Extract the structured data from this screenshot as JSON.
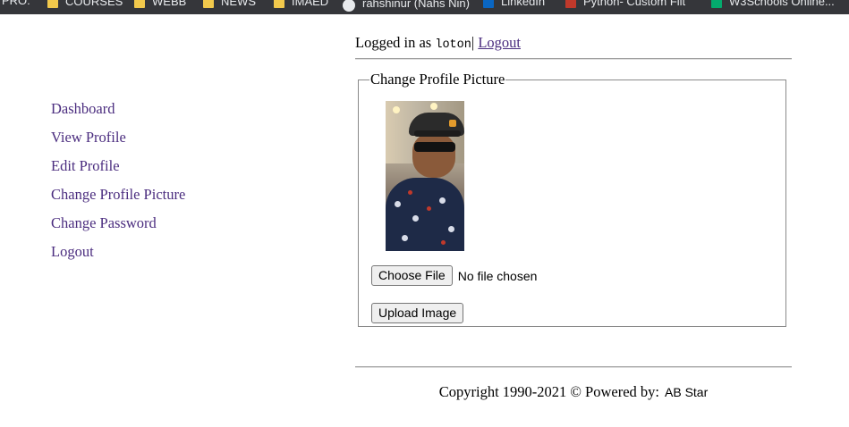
{
  "bookmarks": [
    {
      "label": "PRO:",
      "icon": "none"
    },
    {
      "label": "COURSES",
      "icon": "folder-icon"
    },
    {
      "label": "WEBB",
      "icon": "folder-icon"
    },
    {
      "label": "NEWS",
      "icon": "folder-icon"
    },
    {
      "label": "IMAED",
      "icon": "folder-icon"
    },
    {
      "label": "rahshinur (Nahs Nin)",
      "icon": "github-icon"
    },
    {
      "label": "LinkedIn",
      "icon": "linkedin-icon"
    },
    {
      "label": "Python- Custom Filt",
      "icon": "pdf-icon"
    },
    {
      "label": "W3Schools Online...",
      "icon": "w3schools-icon"
    }
  ],
  "sidebar": {
    "items": [
      "Dashboard",
      "View Profile",
      "Edit Profile",
      "Change Profile Picture",
      "Change Password",
      "Logout"
    ]
  },
  "userbar": {
    "prefix": "Logged in as",
    "username": "loton",
    "separator": "|",
    "logout": "Logout"
  },
  "form": {
    "legend": "Change Profile Picture",
    "choose_file": "Choose File",
    "file_status": "No file chosen",
    "upload": "Upload Image"
  },
  "footer": {
    "text": "Copyright 1990-2021 © Powered by:",
    "brand": "AB Star"
  },
  "colors": {
    "link": "#4b2d7f",
    "bookmark_bar": "#35363a"
  }
}
